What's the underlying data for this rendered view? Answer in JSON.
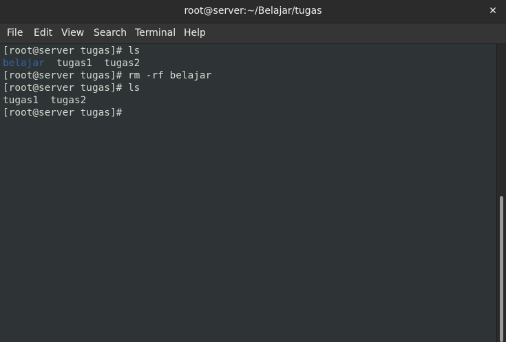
{
  "window": {
    "title": "root@server:~/Belajar/tugas",
    "close_glyph": "✕"
  },
  "menu": [
    "File",
    "Edit",
    "View",
    "Search",
    "Terminal",
    "Help"
  ],
  "terminal": {
    "line1": "[root@server tugas]# ls",
    "line2_dir": "belajar",
    "line2_rest": "  tugas1  tugas2",
    "line3": "[root@server tugas]# rm -rf belajar",
    "line4": "[root@server tugas]# ls",
    "line5": "tugas1  tugas2",
    "line6": "[root@server tugas]#"
  },
  "colors": {
    "background": "#2e3436",
    "text": "#d3d7cf",
    "directory": "#3465a4"
  }
}
